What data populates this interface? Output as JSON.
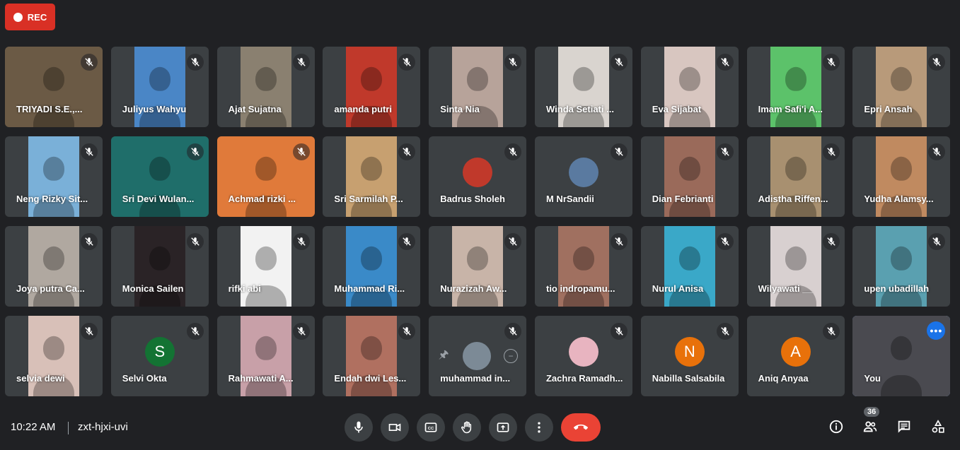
{
  "recording": {
    "label": "REC",
    "color": "#d93025"
  },
  "participants": [
    {
      "name": "TRIYADI S.E.,...",
      "kind": "video",
      "bg": "#6b5a45",
      "full": true
    },
    {
      "name": "Juliyus Wahyu",
      "kind": "video",
      "bg": "#4a86c6"
    },
    {
      "name": "Ajat Sujatna",
      "kind": "video",
      "bg": "#8a8070"
    },
    {
      "name": "amanda putri",
      "kind": "video",
      "bg": "#c0392b"
    },
    {
      "name": "Sinta Nia",
      "kind": "video",
      "bg": "#b7a39a"
    },
    {
      "name": "Winda Setiati ...",
      "kind": "video",
      "bg": "#d9d4cf"
    },
    {
      "name": "Eva Sijabat",
      "kind": "video",
      "bg": "#d8c6c0"
    },
    {
      "name": "Imam Safi'i A...",
      "kind": "video",
      "bg": "#5cc26a"
    },
    {
      "name": "Epri Ansah",
      "kind": "video",
      "bg": "#b89a7a"
    },
    {
      "name": "Neng Rizky Sit...",
      "kind": "video",
      "bg": "#7ab0d8"
    },
    {
      "name": "Sri Devi Wulan...",
      "kind": "video",
      "bg": "#1f6e6a",
      "full": true
    },
    {
      "name": "Achmad rizki ...",
      "kind": "video",
      "bg": "#e07a3a",
      "full": true
    },
    {
      "name": "Sri Sarmilah P...",
      "kind": "video",
      "bg": "#c7a070"
    },
    {
      "name": "Badrus Sholeh",
      "kind": "avatar",
      "avatar_color": "#c0392b"
    },
    {
      "name": "M NrSandii",
      "kind": "avatar",
      "avatar_color": "#5a7aa0"
    },
    {
      "name": "Dian Febrianti",
      "kind": "video",
      "bg": "#9a6a5a"
    },
    {
      "name": "Adistha Riffen...",
      "kind": "video",
      "bg": "#a89070"
    },
    {
      "name": "Yudha Alamsy...",
      "kind": "video",
      "bg": "#c08a60"
    },
    {
      "name": "Joya putra Ca...",
      "kind": "video",
      "bg": "#b0a8a0"
    },
    {
      "name": "Monica Sailen",
      "kind": "video",
      "bg": "#2a2326"
    },
    {
      "name": "rifki abi",
      "kind": "video",
      "bg": "#f2f2f2"
    },
    {
      "name": "Muhammad Ri...",
      "kind": "video",
      "bg": "#3a8ac8"
    },
    {
      "name": "Nurazizah Aw...",
      "kind": "video",
      "bg": "#c8b4a8"
    },
    {
      "name": "tio indropamu...",
      "kind": "video",
      "bg": "#a07060"
    },
    {
      "name": "Nurul Anisa",
      "kind": "video",
      "bg": "#3aa8c8"
    },
    {
      "name": "Wilyawati __",
      "kind": "video",
      "bg": "#d8d0d0"
    },
    {
      "name": "upen ubadillah",
      "kind": "video",
      "bg": "#5aa0b0"
    },
    {
      "name": "selvia dewi",
      "kind": "video",
      "bg": "#d8c0b8"
    },
    {
      "name": "Selvi Okta",
      "kind": "avatar",
      "letter": "S",
      "avatar_color": "#137333"
    },
    {
      "name": "Rahmawati A...",
      "kind": "video",
      "bg": "#c8a0a8"
    },
    {
      "name": "Endah dwi Les...",
      "kind": "video",
      "bg": "#b07060"
    },
    {
      "name": "muhammad in...",
      "kind": "pinned"
    },
    {
      "name": "Zachra Ramadh...",
      "kind": "avatar",
      "avatar_color": "#e8b4c0"
    },
    {
      "name": "Nabilla Salsabila",
      "kind": "avatar",
      "letter": "N",
      "avatar_color": "#e8710a"
    },
    {
      "name": "Aniq Anyaa",
      "kind": "avatar",
      "letter": "A",
      "avatar_color": "#e8710a"
    },
    {
      "name": "You",
      "kind": "self",
      "bg": "#4a4a50"
    }
  ],
  "footer": {
    "time": "10:22 AM",
    "meeting_code": "zxt-hjxi-uvi",
    "participants_count": "36"
  }
}
